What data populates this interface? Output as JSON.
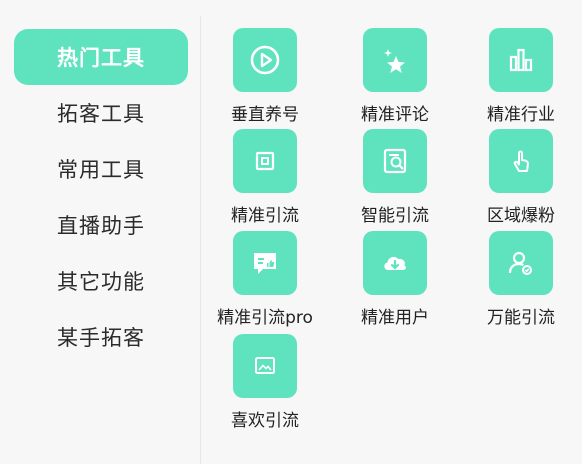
{
  "sidebar": {
    "items": [
      {
        "label": "热门工具",
        "active": true
      },
      {
        "label": "拓客工具",
        "active": false
      },
      {
        "label": "常用工具",
        "active": false
      },
      {
        "label": "直播助手",
        "active": false
      },
      {
        "label": "其它功能",
        "active": false
      },
      {
        "label": "某手拓客",
        "active": false
      }
    ]
  },
  "tools": [
    {
      "label": "垂直养号",
      "icon": "play-circle-icon"
    },
    {
      "label": "精准评论",
      "icon": "star-sparkle-icon"
    },
    {
      "label": "精准行业",
      "icon": "bar-chart-icon"
    },
    {
      "label": "精准引流",
      "icon": "target-square-icon"
    },
    {
      "label": "智能引流",
      "icon": "search-doc-icon"
    },
    {
      "label": "区域爆粉",
      "icon": "hand-tap-icon"
    },
    {
      "label": "精准引流pro",
      "icon": "chat-like-icon"
    },
    {
      "label": "精准用户",
      "icon": "cloud-download-icon"
    },
    {
      "label": "万能引流",
      "icon": "user-check-icon"
    },
    {
      "label": "喜欢引流",
      "icon": "image-frame-icon"
    }
  ],
  "colors": {
    "accent": "#5fe3bf",
    "background": "#f7f7f8",
    "text": "#222222"
  }
}
